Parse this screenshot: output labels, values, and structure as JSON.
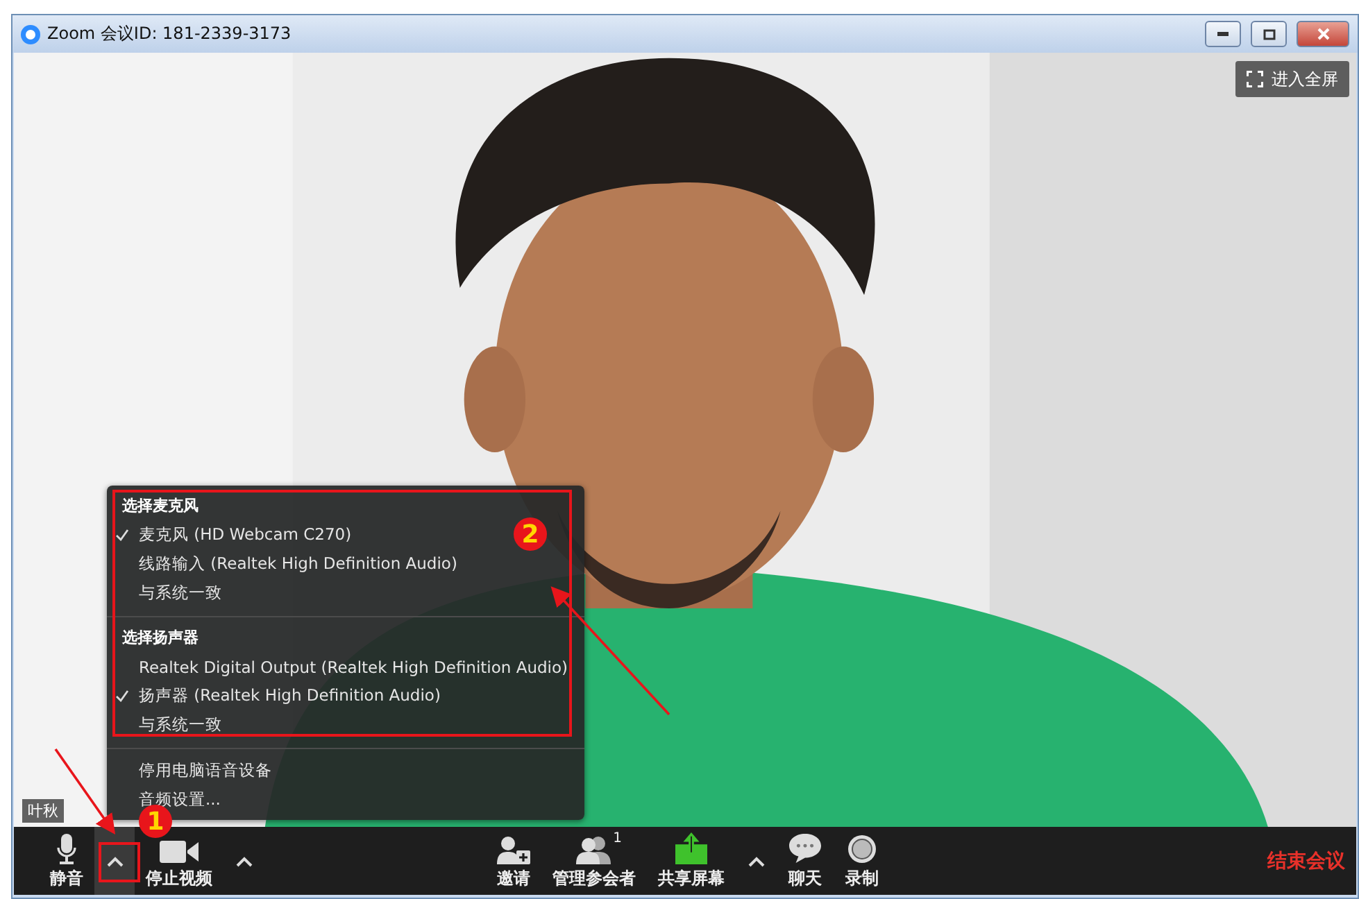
{
  "window": {
    "title": "Zoom 会议ID: 181-2339-3173"
  },
  "fullscreen_button": "进入全屏",
  "video": {
    "kind": "picture",
    "name_tag": "叶秋"
  },
  "audio_menu": {
    "sections": [
      {
        "heading": "选择麦克风",
        "items": [
          {
            "label": "麦克风 (HD Webcam C270)",
            "checked": true
          },
          {
            "label": "线路输入 (Realtek High Definition Audio)",
            "checked": false
          },
          {
            "label": "与系统一致",
            "checked": false
          }
        ]
      },
      {
        "heading": "选择扬声器",
        "items": [
          {
            "label": "Realtek Digital Output (Realtek High Definition Audio)",
            "checked": false
          },
          {
            "label": "扬声器 (Realtek High Definition Audio)",
            "checked": true
          },
          {
            "label": "与系统一致",
            "checked": false
          }
        ]
      }
    ],
    "actions": [
      "停用电脑语音设备",
      "音频设置..."
    ]
  },
  "toolbar": {
    "left": [
      {
        "kind": "mic",
        "label": "静音"
      },
      {
        "kind": "caret",
        "selected": true
      },
      {
        "kind": "camera",
        "label": "停止视频"
      },
      {
        "kind": "caret",
        "selected": false
      }
    ],
    "center": [
      {
        "kind": "invite",
        "label": "邀请"
      },
      {
        "kind": "participants",
        "label": "管理参会者",
        "count": "1"
      },
      {
        "kind": "share",
        "label": "共享屏幕"
      },
      {
        "kind": "caret",
        "selected": false
      },
      {
        "kind": "chat",
        "label": "聊天"
      },
      {
        "kind": "record",
        "label": "录制"
      }
    ],
    "end_button": "结束会议"
  },
  "annotations": [
    {
      "label": "1"
    },
    {
      "label": "2"
    }
  ]
}
